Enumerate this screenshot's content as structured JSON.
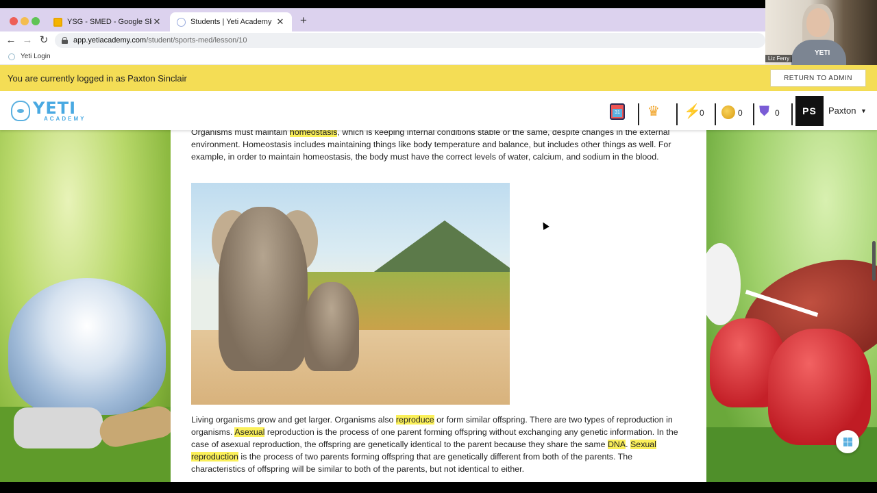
{
  "browser": {
    "tabs": [
      {
        "title": "YSG - SMED - Google Slides"
      },
      {
        "title": "Students | Yeti Academy"
      }
    ],
    "url_host": "app.yetiacademy.com",
    "url_path": "/student/sports-med/lesson/10",
    "bookmark": "Yeti Login"
  },
  "webcam": {
    "name": "Liz Ferry",
    "shirt_logo": "YETI"
  },
  "banner": {
    "message": "You are currently logged in as Paxton Sinclair",
    "return_button": "RETURN TO ADMIN"
  },
  "header": {
    "logo_word": "YETI",
    "logo_sub": "ACADEMY",
    "calendar_day": "31",
    "energy_count": "0",
    "coin_count": "0",
    "shield_count": "0",
    "avatar_initials": "PS",
    "user_name": "Paxton"
  },
  "lesson": {
    "para1": {
      "a": "Organisms must maintain ",
      "hl1": "homeostasis",
      "b": ", which is keeping internal conditions stable or the same, despite changes in the external environment.  Homeostasis includes maintaining things like body temperature and balance, but includes other things as well. For example, in order to maintain homeostasis, the body must have the correct levels of water, calcium, and sodium in the blood."
    },
    "para2": {
      "a": "Living organisms grow and get larger.  Organisms also ",
      "hl1": "reproduce",
      "b": " or form similar offspring. There are two types of reproduction in organisms.  ",
      "hl2": "Asexual",
      "c": " reproduction is the process of one parent forming offspring without exchanging any genetic information. In the case of asexual reproduction, the offspring are genetically identical to the parent because they share the same ",
      "hl3": "DNA",
      "d": ".  ",
      "hl4": "Sexual reproduction",
      "e": " is the process of two parents forming offspring that are genetically different from both of the parents.  The characteristics of offspring will be similar to both of the parents, but not identical to either."
    }
  },
  "colors": {
    "banner": "#f4dd55",
    "highlight": "#fbf05a",
    "brand": "#49a9e2"
  }
}
